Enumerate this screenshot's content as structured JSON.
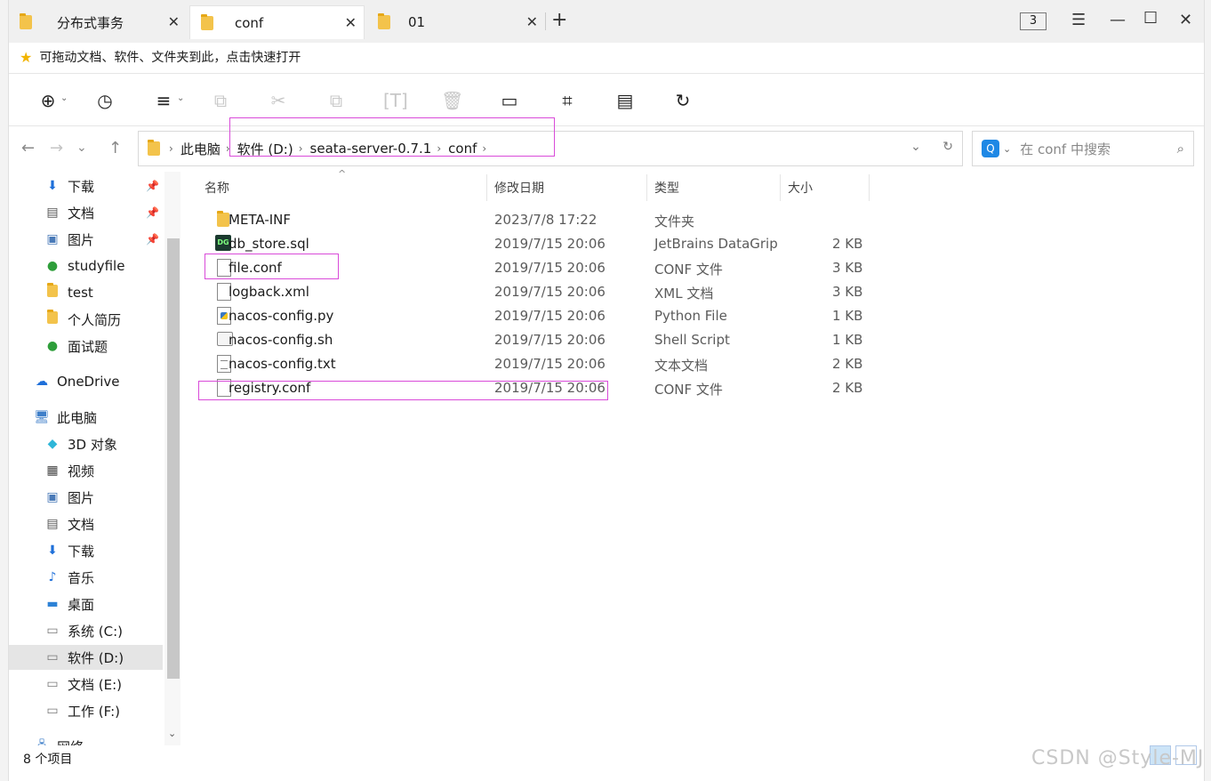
{
  "tabs": [
    {
      "label": "分布式事务"
    },
    {
      "label": "conf"
    },
    {
      "label": "01"
    }
  ],
  "window": {
    "badge": "3"
  },
  "quickbar": {
    "text": "可拖动文档、软件、文件夹到此，点击快速打开"
  },
  "breadcrumb": [
    "此电脑",
    "软件 (D:)",
    "seata-server-0.7.1",
    "conf"
  ],
  "search": {
    "placeholder": "在 conf 中搜索"
  },
  "sidebar": {
    "items": [
      {
        "label": "下载",
        "icon": "download-arrow-icon",
        "pinned": true
      },
      {
        "label": "文档",
        "icon": "document-icon",
        "pinned": true
      },
      {
        "label": "图片",
        "icon": "picture-icon",
        "pinned": true
      },
      {
        "label": "studyfile",
        "icon": "folder-synced-icon"
      },
      {
        "label": "test",
        "icon": "folder-icon"
      },
      {
        "label": "个人简历",
        "icon": "folder-icon"
      },
      {
        "label": "面试题",
        "icon": "folder-synced-icon"
      },
      {
        "label": "OneDrive",
        "icon": "cloud-icon"
      },
      {
        "label": "此电脑",
        "icon": "computer-icon"
      },
      {
        "label": "3D 对象",
        "icon": "cube-icon"
      },
      {
        "label": "视频",
        "icon": "video-icon"
      },
      {
        "label": "图片",
        "icon": "picture-icon"
      },
      {
        "label": "文档",
        "icon": "document-icon"
      },
      {
        "label": "下载",
        "icon": "download-arrow-icon"
      },
      {
        "label": "音乐",
        "icon": "music-note-icon"
      },
      {
        "label": "桌面",
        "icon": "desktop-icon"
      },
      {
        "label": "系统 (C:)",
        "icon": "drive-windows-icon"
      },
      {
        "label": "软件 (D:)",
        "icon": "drive-icon",
        "selected": true
      },
      {
        "label": "文档 (E:)",
        "icon": "drive-icon"
      },
      {
        "label": "工作 (F:)",
        "icon": "drive-icon"
      },
      {
        "label": "网络",
        "icon": "network-icon"
      }
    ]
  },
  "columns": {
    "name": "名称",
    "modified": "修改日期",
    "type": "类型",
    "size": "大小"
  },
  "files": [
    {
      "name": "META-INF",
      "modified": "2023/7/8 17:22",
      "type": "文件夹",
      "size": "",
      "icon": "folder-icon"
    },
    {
      "name": "db_store.sql",
      "modified": "2019/7/15 20:06",
      "type": "JetBrains DataGrip",
      "size": "2 KB",
      "icon": "datagrip-icon"
    },
    {
      "name": "file.conf",
      "modified": "2019/7/15 20:06",
      "type": "CONF 文件",
      "size": "3 KB",
      "icon": "blank-file-icon"
    },
    {
      "name": "logback.xml",
      "modified": "2019/7/15 20:06",
      "type": "XML 文档",
      "size": "3 KB",
      "icon": "blank-file-icon"
    },
    {
      "name": "nacos-config.py",
      "modified": "2019/7/15 20:06",
      "type": "Python File",
      "size": "1 KB",
      "icon": "python-file-icon"
    },
    {
      "name": "nacos-config.sh",
      "modified": "2019/7/15 20:06",
      "type": "Shell Script",
      "size": "1 KB",
      "icon": "shell-script-icon"
    },
    {
      "name": "nacos-config.txt",
      "modified": "2019/7/15 20:06",
      "type": "文本文档",
      "size": "2 KB",
      "icon": "text-file-icon"
    },
    {
      "name": "registry.conf",
      "modified": "2019/7/15 20:06",
      "type": "CONF 文件",
      "size": "2 KB",
      "icon": "blank-file-icon"
    }
  ],
  "status": {
    "item_count": "8 个项目"
  },
  "watermark": "CSDN @Style-MJ",
  "colors": {
    "annotation": "#d94bd9",
    "selection": "#e5e5e5",
    "search_accent": "#1e88e5"
  }
}
